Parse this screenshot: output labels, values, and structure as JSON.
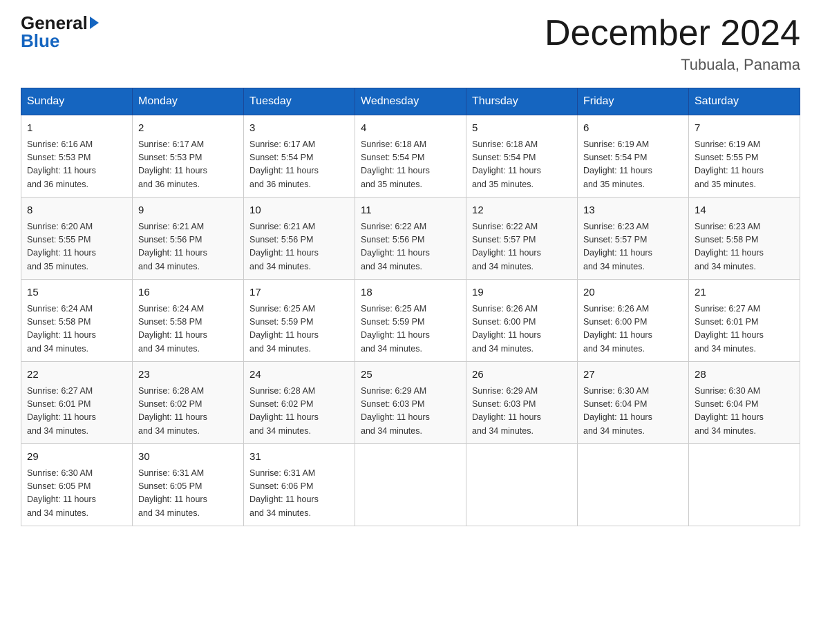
{
  "header": {
    "logo_general": "General",
    "logo_blue": "Blue",
    "title": "December 2024",
    "location": "Tubuala, Panama"
  },
  "days_of_week": [
    "Sunday",
    "Monday",
    "Tuesday",
    "Wednesday",
    "Thursday",
    "Friday",
    "Saturday"
  ],
  "weeks": [
    [
      {
        "day": "1",
        "sunrise": "6:16 AM",
        "sunset": "5:53 PM",
        "daylight": "11 hours and 36 minutes."
      },
      {
        "day": "2",
        "sunrise": "6:17 AM",
        "sunset": "5:53 PM",
        "daylight": "11 hours and 36 minutes."
      },
      {
        "day": "3",
        "sunrise": "6:17 AM",
        "sunset": "5:54 PM",
        "daylight": "11 hours and 36 minutes."
      },
      {
        "day": "4",
        "sunrise": "6:18 AM",
        "sunset": "5:54 PM",
        "daylight": "11 hours and 35 minutes."
      },
      {
        "day": "5",
        "sunrise": "6:18 AM",
        "sunset": "5:54 PM",
        "daylight": "11 hours and 35 minutes."
      },
      {
        "day": "6",
        "sunrise": "6:19 AM",
        "sunset": "5:54 PM",
        "daylight": "11 hours and 35 minutes."
      },
      {
        "day": "7",
        "sunrise": "6:19 AM",
        "sunset": "5:55 PM",
        "daylight": "11 hours and 35 minutes."
      }
    ],
    [
      {
        "day": "8",
        "sunrise": "6:20 AM",
        "sunset": "5:55 PM",
        "daylight": "11 hours and 35 minutes."
      },
      {
        "day": "9",
        "sunrise": "6:21 AM",
        "sunset": "5:56 PM",
        "daylight": "11 hours and 34 minutes."
      },
      {
        "day": "10",
        "sunrise": "6:21 AM",
        "sunset": "5:56 PM",
        "daylight": "11 hours and 34 minutes."
      },
      {
        "day": "11",
        "sunrise": "6:22 AM",
        "sunset": "5:56 PM",
        "daylight": "11 hours and 34 minutes."
      },
      {
        "day": "12",
        "sunrise": "6:22 AM",
        "sunset": "5:57 PM",
        "daylight": "11 hours and 34 minutes."
      },
      {
        "day": "13",
        "sunrise": "6:23 AM",
        "sunset": "5:57 PM",
        "daylight": "11 hours and 34 minutes."
      },
      {
        "day": "14",
        "sunrise": "6:23 AM",
        "sunset": "5:58 PM",
        "daylight": "11 hours and 34 minutes."
      }
    ],
    [
      {
        "day": "15",
        "sunrise": "6:24 AM",
        "sunset": "5:58 PM",
        "daylight": "11 hours and 34 minutes."
      },
      {
        "day": "16",
        "sunrise": "6:24 AM",
        "sunset": "5:58 PM",
        "daylight": "11 hours and 34 minutes."
      },
      {
        "day": "17",
        "sunrise": "6:25 AM",
        "sunset": "5:59 PM",
        "daylight": "11 hours and 34 minutes."
      },
      {
        "day": "18",
        "sunrise": "6:25 AM",
        "sunset": "5:59 PM",
        "daylight": "11 hours and 34 minutes."
      },
      {
        "day": "19",
        "sunrise": "6:26 AM",
        "sunset": "6:00 PM",
        "daylight": "11 hours and 34 minutes."
      },
      {
        "day": "20",
        "sunrise": "6:26 AM",
        "sunset": "6:00 PM",
        "daylight": "11 hours and 34 minutes."
      },
      {
        "day": "21",
        "sunrise": "6:27 AM",
        "sunset": "6:01 PM",
        "daylight": "11 hours and 34 minutes."
      }
    ],
    [
      {
        "day": "22",
        "sunrise": "6:27 AM",
        "sunset": "6:01 PM",
        "daylight": "11 hours and 34 minutes."
      },
      {
        "day": "23",
        "sunrise": "6:28 AM",
        "sunset": "6:02 PM",
        "daylight": "11 hours and 34 minutes."
      },
      {
        "day": "24",
        "sunrise": "6:28 AM",
        "sunset": "6:02 PM",
        "daylight": "11 hours and 34 minutes."
      },
      {
        "day": "25",
        "sunrise": "6:29 AM",
        "sunset": "6:03 PM",
        "daylight": "11 hours and 34 minutes."
      },
      {
        "day": "26",
        "sunrise": "6:29 AM",
        "sunset": "6:03 PM",
        "daylight": "11 hours and 34 minutes."
      },
      {
        "day": "27",
        "sunrise": "6:30 AM",
        "sunset": "6:04 PM",
        "daylight": "11 hours and 34 minutes."
      },
      {
        "day": "28",
        "sunrise": "6:30 AM",
        "sunset": "6:04 PM",
        "daylight": "11 hours and 34 minutes."
      }
    ],
    [
      {
        "day": "29",
        "sunrise": "6:30 AM",
        "sunset": "6:05 PM",
        "daylight": "11 hours and 34 minutes."
      },
      {
        "day": "30",
        "sunrise": "6:31 AM",
        "sunset": "6:05 PM",
        "daylight": "11 hours and 34 minutes."
      },
      {
        "day": "31",
        "sunrise": "6:31 AM",
        "sunset": "6:06 PM",
        "daylight": "11 hours and 34 minutes."
      },
      null,
      null,
      null,
      null
    ]
  ]
}
